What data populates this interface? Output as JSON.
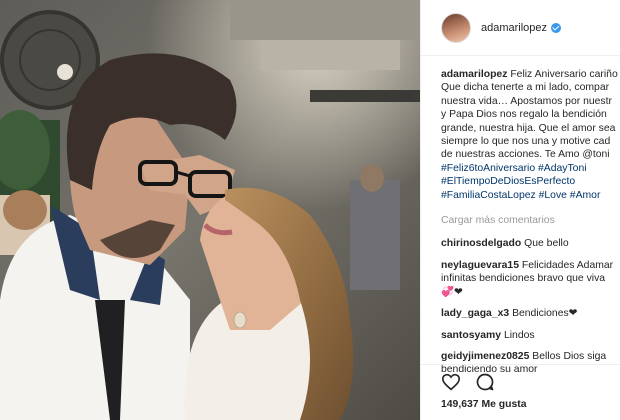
{
  "post": {
    "username": "adamarilopez",
    "caption_lines": [
      "Feliz Aniversario cariño",
      "Que dicha tenerte a mi lado, compar",
      "nuestra vida… Apostamos por nuestr",
      "y Papa Dios nos regalo la bendición",
      "grande, nuestra hija. Que el amor sea",
      "siempre lo que nos una y motive cad",
      "de nuestras acciones. Te Amo @toni"
    ],
    "hashtag_lines": [
      "#Feliz6toAniversario #AdayToni",
      "#ElTiempoDeDiosEsPerfecto",
      "#FamiliaCostaLopez #Love #Amor"
    ],
    "load_more": "Cargar más comentarios",
    "comments": [
      {
        "user": "chirinosdelgado",
        "lines": [
          "Que bello"
        ]
      },
      {
        "user": "neylaguevara15",
        "lines": [
          "Felicidades Adamar",
          "infinitas bendiciones bravo que viva",
          "💞❤"
        ]
      },
      {
        "user": "lady_gaga_x3",
        "lines": [
          "Bendiciones❤"
        ]
      },
      {
        "user": "santosyamy",
        "lines": [
          "Lindos"
        ]
      },
      {
        "user": "geidyjimenez0825",
        "lines": [
          "Bellos Dios siga",
          "bendiciendo su amor"
        ]
      }
    ],
    "likes_text": "149,637 Me gusta",
    "icons": {
      "like": "heart-icon",
      "comment": "comment-icon",
      "verified": "verified-badge-icon"
    }
  }
}
